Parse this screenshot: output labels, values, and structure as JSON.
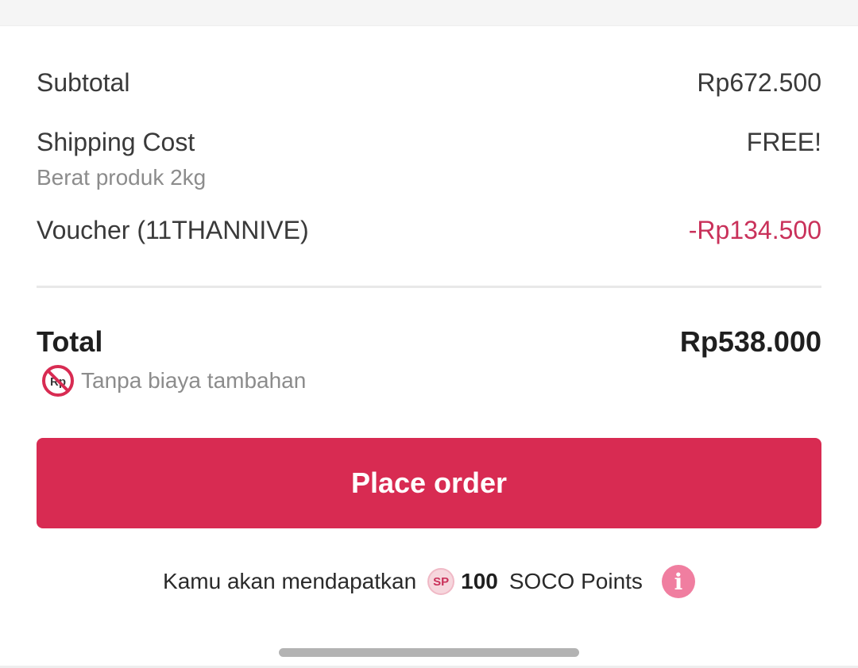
{
  "summary": {
    "subtotal_label": "Subtotal",
    "subtotal_value": "Rp672.500",
    "shipping_label": "Shipping Cost",
    "shipping_value": "FREE!",
    "shipping_note": "Berat produk 2kg",
    "voucher_label": "Voucher (11THANNIVE)",
    "voucher_value": "-Rp134.500"
  },
  "total": {
    "label": "Total",
    "value": "Rp538.000",
    "fee_icon_text": "Rp",
    "fee_note": "Tanpa biaya tambahan"
  },
  "actions": {
    "place_order_label": "Place order"
  },
  "points": {
    "prefix": "Kamu akan mendapatkan",
    "badge": "SP",
    "amount": "100",
    "suffix": "SOCO Points",
    "info_icon": "i"
  },
  "colors": {
    "accent": "#d82b52",
    "discount": "#c9315a",
    "info": "#f07ea0"
  }
}
